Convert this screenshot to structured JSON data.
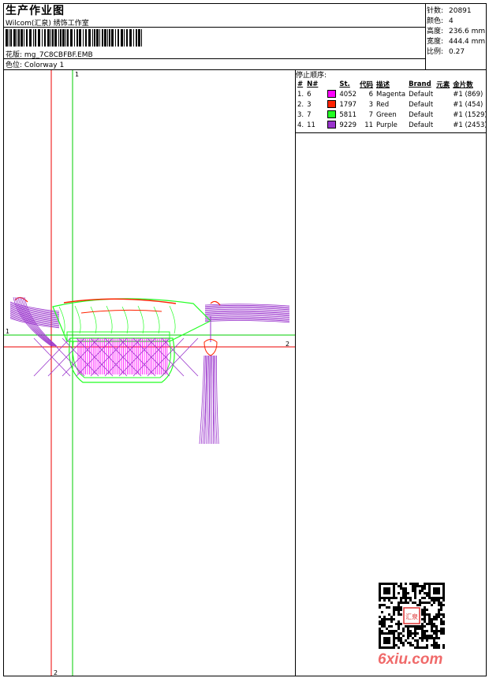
{
  "header": {
    "title": "生产作业图",
    "company": "Wilcom(汇泉) 绣饰工作室",
    "design_label": "花版:",
    "design_value": "mg_7C8CBFBF.EMB",
    "colorway_label": "色位:",
    "colorway_value": "Colorway 1"
  },
  "stats": [
    {
      "label": "针数:",
      "value": "20891"
    },
    {
      "label": "颜色:",
      "value": "4"
    },
    {
      "label": "高度:",
      "value": "236.6 mm"
    },
    {
      "label": "宽度:",
      "value": "444.4 mm"
    },
    {
      "label": "比例:",
      "value": "0.27"
    }
  ],
  "stop_sequence": {
    "title": "停止顺序:",
    "headers": [
      "#",
      "N#",
      "St.",
      "代码",
      "描述",
      "Brand",
      "元素",
      "金片数"
    ],
    "rows": [
      {
        "num": "1.",
        "n": "6",
        "color": "#ff00ff",
        "st": "4052",
        "code": "6",
        "desc": "Magenta",
        "brand": "Default",
        "element": "",
        "sequins": "#1 (869)"
      },
      {
        "num": "2.",
        "n": "3",
        "color": "#ff2200",
        "st": "1797",
        "code": "3",
        "desc": "Red",
        "brand": "Default",
        "element": "",
        "sequins": "#1 (454)"
      },
      {
        "num": "3.",
        "n": "7",
        "color": "#22ff22",
        "st": "5811",
        "code": "7",
        "desc": "Green",
        "brand": "Default",
        "element": "",
        "sequins": "#1 (1529)"
      },
      {
        "num": "4.",
        "n": "11",
        "color": "#9933cc",
        "st": "9229",
        "code": "11",
        "desc": "Purple",
        "brand": "Default",
        "element": "",
        "sequins": "#1 (2453)"
      }
    ]
  },
  "guides": {
    "v1": "1",
    "v2": "2",
    "h1": "1",
    "h2": "2"
  },
  "watermark": "6xiu.com",
  "seal_text": "汇泉"
}
